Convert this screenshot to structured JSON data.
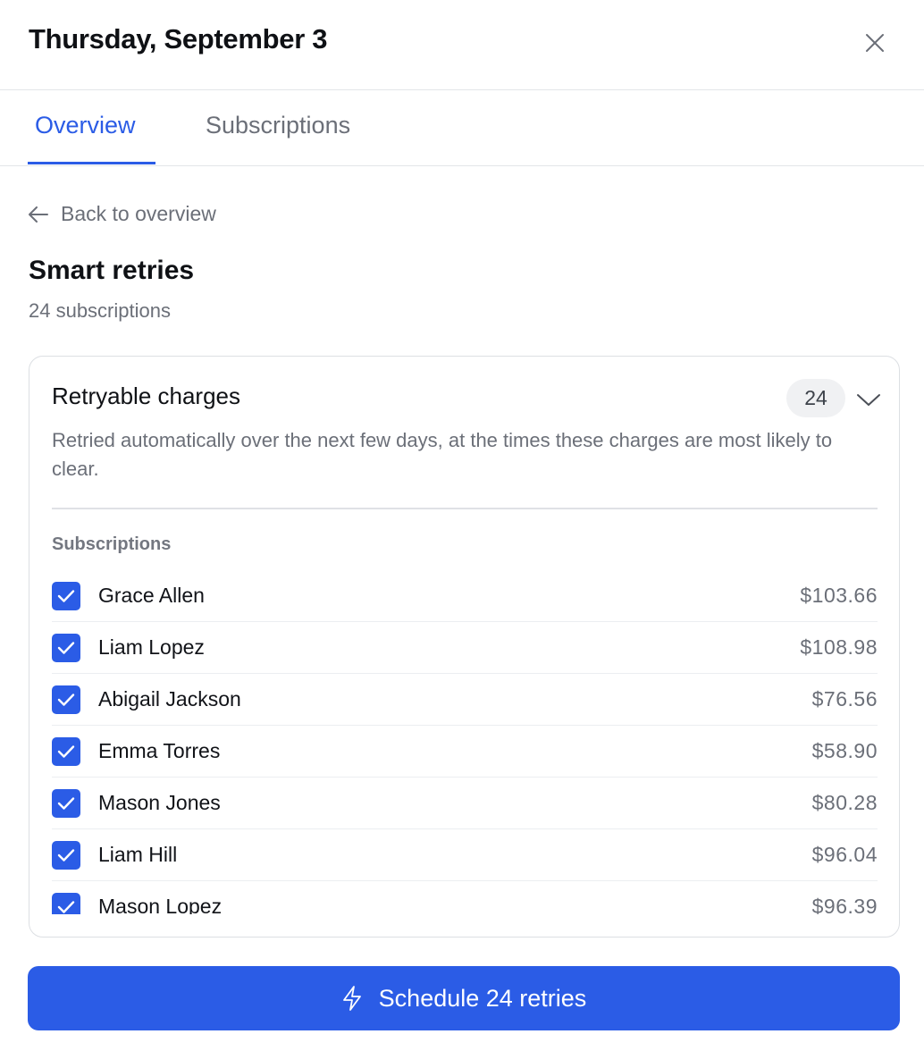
{
  "header": {
    "title": "Thursday, September 3"
  },
  "tabs": [
    {
      "label": "Overview",
      "active": true
    },
    {
      "label": "Subscriptions",
      "active": false
    }
  ],
  "back_link": {
    "label": "Back to overview"
  },
  "section": {
    "title": "Smart retries",
    "subtitle": "24 subscriptions"
  },
  "card": {
    "title": "Retryable charges",
    "count": "24",
    "description": "Retried automatically over the next few days, at the times these charges are most likely to clear.",
    "list_label": "Subscriptions",
    "rows": [
      {
        "name": "Grace Allen",
        "amount": "$103.66",
        "checked": true
      },
      {
        "name": "Liam Lopez",
        "amount": "$108.98",
        "checked": true
      },
      {
        "name": "Abigail Jackson",
        "amount": "$76.56",
        "checked": true
      },
      {
        "name": "Emma Torres",
        "amount": "$58.90",
        "checked": true
      },
      {
        "name": "Mason Jones",
        "amount": "$80.28",
        "checked": true
      },
      {
        "name": "Liam Hill",
        "amount": "$96.04",
        "checked": true
      },
      {
        "name": "Mason Lopez",
        "amount": "$96.39",
        "checked": true
      }
    ]
  },
  "action": {
    "label": "Schedule 24 retries"
  },
  "colors": {
    "accent": "#2b5ce6",
    "muted_text": "#6b6f78",
    "border": "#dcdfe3"
  },
  "icons": {
    "close": "close-icon",
    "back": "arrow-left-icon",
    "chevron": "chevron-down-icon",
    "check": "check-icon",
    "bolt": "lightning-bolt-icon"
  }
}
